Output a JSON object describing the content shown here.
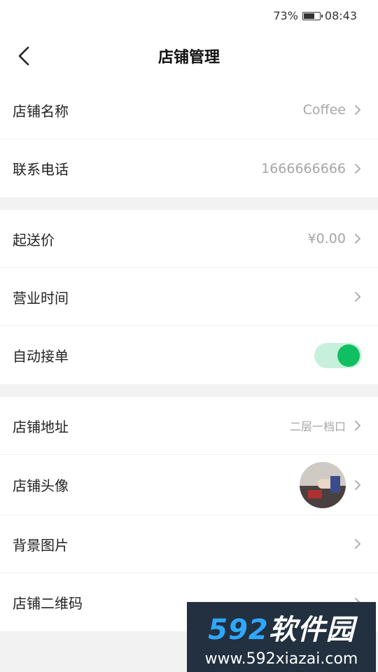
{
  "status": {
    "battery": "73%",
    "time": "08:43",
    "battery_level": 0.73
  },
  "nav": {
    "title": "店铺管理"
  },
  "groups": [
    {
      "items": [
        {
          "label": "店铺名称",
          "value": "Coffee"
        },
        {
          "label": "联系电话",
          "value": "1666666666"
        }
      ]
    },
    {
      "items": [
        {
          "label": "起送价",
          "value": "¥0.00"
        },
        {
          "label": "营业时间",
          "value": ""
        },
        {
          "label": "自动接单",
          "toggle": true
        }
      ]
    },
    {
      "items": [
        {
          "label": "店铺地址",
          "value": "二层一档口"
        },
        {
          "label": "店铺头像"
        },
        {
          "label": "背景图片"
        },
        {
          "label": "店铺二维码"
        }
      ]
    }
  ],
  "watermark": {
    "brand_num": "592",
    "brand_text": "软件园",
    "url": "www.592xiazai.com"
  },
  "colors": {
    "accent": "#10c060",
    "toggle_track": "#c7f0dc"
  }
}
